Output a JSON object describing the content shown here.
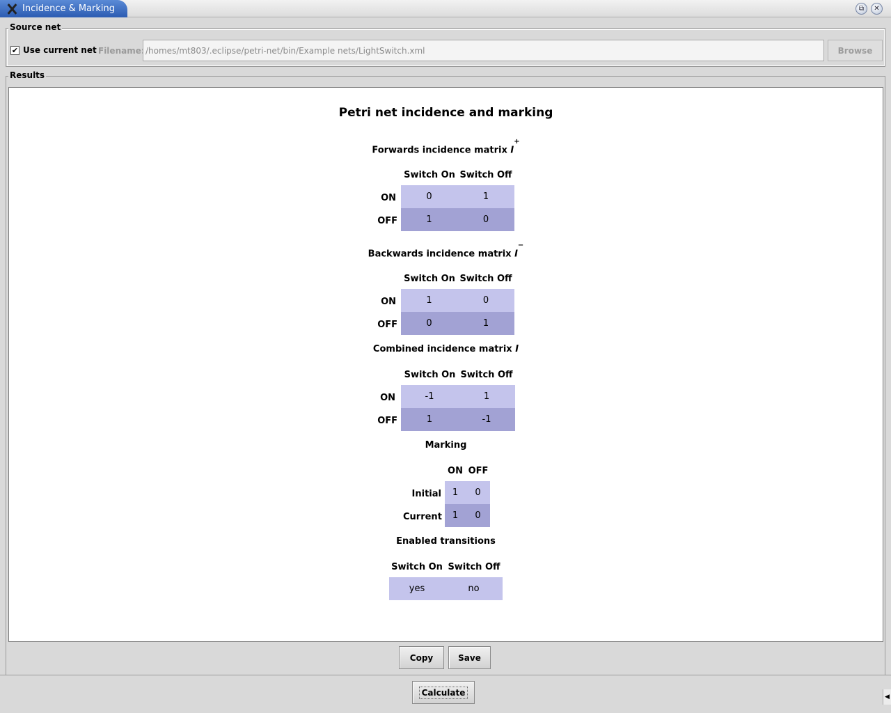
{
  "window": {
    "title": "Incidence & Marking"
  },
  "source": {
    "group_label": "Source net",
    "use_current_label": "Use current net",
    "use_current_checked": true,
    "filename_label": "Filename:",
    "filename_value": "/homes/mt803/.eclipse/petri-net/bin/Example nets/LightSwitch.xml",
    "browse_label": "Browse"
  },
  "results": {
    "group_label": "Results",
    "heading": "Petri net incidence and marking",
    "forwards": {
      "title": "Forwards incidence matrix ",
      "symbol": "I",
      "sup": "+",
      "columns": [
        "Switch On",
        "Switch Off"
      ],
      "rows": [
        {
          "label": "ON",
          "values": [
            "0",
            "1"
          ]
        },
        {
          "label": "OFF",
          "values": [
            "1",
            "0"
          ]
        }
      ]
    },
    "backwards": {
      "title": "Backwards incidence matrix ",
      "symbol": "I",
      "sup": "−",
      "columns": [
        "Switch On",
        "Switch Off"
      ],
      "rows": [
        {
          "label": "ON",
          "values": [
            "1",
            "0"
          ]
        },
        {
          "label": "OFF",
          "values": [
            "0",
            "1"
          ]
        }
      ]
    },
    "combined": {
      "title": "Combined incidence matrix ",
      "symbol": "I",
      "columns": [
        "Switch On",
        "Switch Off"
      ],
      "rows": [
        {
          "label": "ON",
          "values": [
            "-1",
            "1"
          ]
        },
        {
          "label": "OFF",
          "values": [
            "1",
            "-1"
          ]
        }
      ]
    },
    "marking": {
      "title": "Marking",
      "columns": [
        "ON",
        "OFF"
      ],
      "rows": [
        {
          "label": "Initial",
          "values": [
            "1",
            "0"
          ]
        },
        {
          "label": "Current",
          "values": [
            "1",
            "0"
          ]
        }
      ]
    },
    "enabled": {
      "title": "Enabled transitions",
      "columns": [
        "Switch On",
        "Switch Off"
      ],
      "values": [
        "yes",
        "no"
      ]
    }
  },
  "actions": {
    "copy_label": "Copy",
    "save_label": "Save",
    "calculate_label": "Calculate"
  },
  "colors": {
    "row_light": "#c4c4ec",
    "row_dark": "#a2a2d4",
    "title_accent": "#2c5cb2"
  }
}
